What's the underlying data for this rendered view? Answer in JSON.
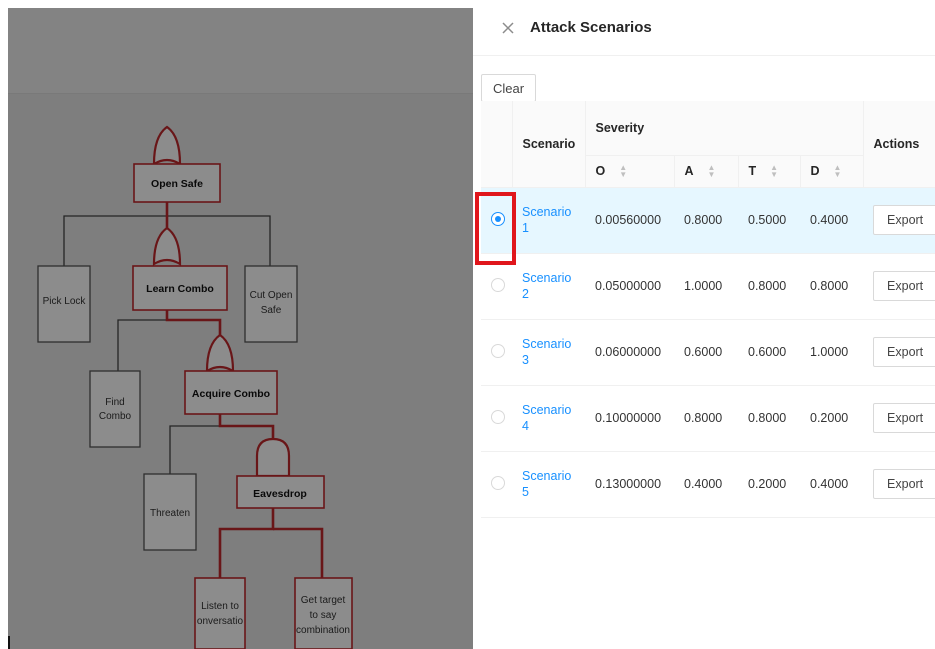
{
  "drawer": {
    "title": "Attack Scenarios",
    "clear_label": "Clear"
  },
  "table": {
    "headers": {
      "scenario": "Scenario",
      "severity": "Severity",
      "actions": "Actions",
      "severity_cols": [
        "O",
        "A",
        "T",
        "D"
      ]
    },
    "rows": [
      {
        "name": "Scenario 1",
        "o": "0.00560000",
        "a": "0.8000",
        "t": "0.5000",
        "d": "0.4000",
        "action": "Export",
        "selected": true
      },
      {
        "name": "Scenario 2",
        "o": "0.05000000",
        "a": "1.0000",
        "t": "0.8000",
        "d": "0.8000",
        "action": "Export",
        "selected": false
      },
      {
        "name": "Scenario 3",
        "o": "0.06000000",
        "a": "0.6000",
        "t": "0.6000",
        "d": "1.0000",
        "action": "Export",
        "selected": false
      },
      {
        "name": "Scenario 4",
        "o": "0.10000000",
        "a": "0.8000",
        "t": "0.8000",
        "d": "0.2000",
        "action": "Export",
        "selected": false
      },
      {
        "name": "Scenario 5",
        "o": "0.13000000",
        "a": "0.4000",
        "t": "0.2000",
        "d": "0.4000",
        "action": "Export",
        "selected": false
      }
    ]
  },
  "tree": {
    "root": "Open Safe",
    "pick_lock": "Pick Lock",
    "learn_combo": "Learn Combo",
    "cut_open_safe": [
      "Cut Open",
      "Safe"
    ],
    "find_combo": [
      "Find",
      "Combo"
    ],
    "acquire_combo": "Acquire Combo",
    "threaten": "Threaten",
    "eavesdrop": "Eavesdrop",
    "listen": [
      "Listen to",
      "onversatio"
    ],
    "get_target": [
      "Get target",
      "to say",
      "combination"
    ]
  },
  "colors": {
    "accent": "#1890ff",
    "selected_row": "#e6f7ff",
    "attack_path": "#c0282d",
    "annotation": "#e0161c"
  },
  "icons": {
    "close": "close-icon",
    "sort": "sort-caret-icon"
  }
}
